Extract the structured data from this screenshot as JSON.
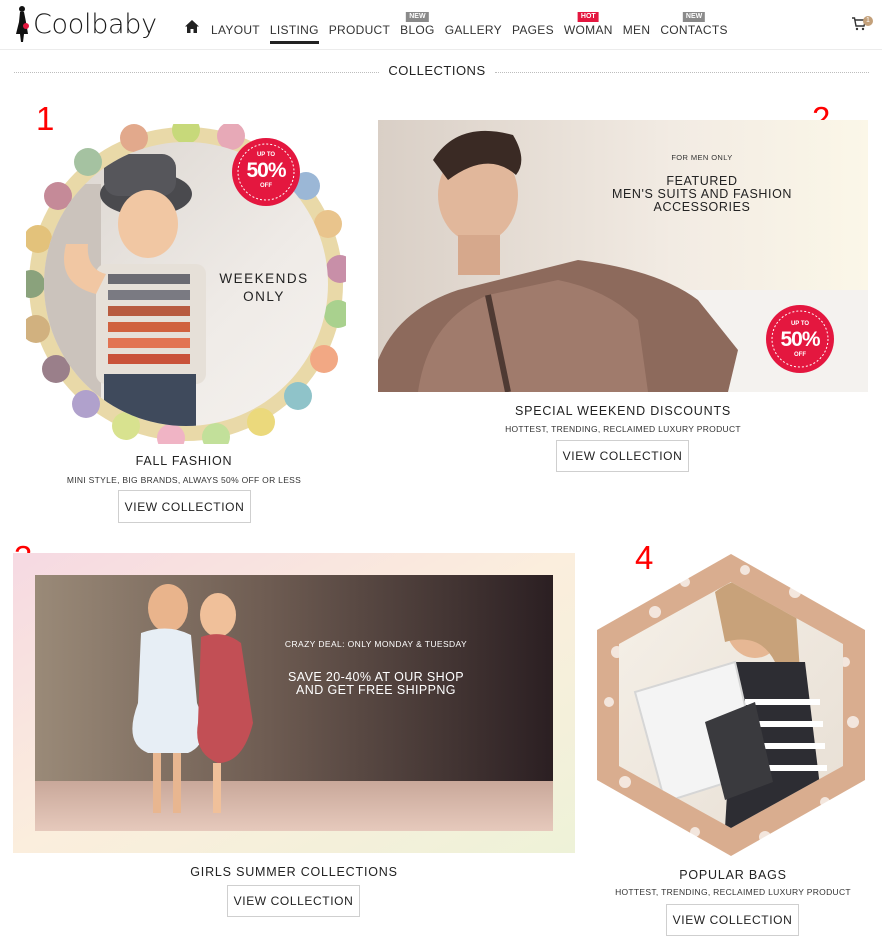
{
  "header": {
    "logo_text": "Coolbaby",
    "nav": [
      {
        "label": "LAYOUT",
        "badge": ""
      },
      {
        "label": "LISTING",
        "badge": ""
      },
      {
        "label": "PRODUCT",
        "badge": ""
      },
      {
        "label": "BLOG",
        "badge": "NEW"
      },
      {
        "label": "GALLERY",
        "badge": ""
      },
      {
        "label": "PAGES",
        "badge": ""
      },
      {
        "label": "WOMAN",
        "badge": "HOT"
      },
      {
        "label": "MEN",
        "badge": ""
      },
      {
        "label": "CONTACTS",
        "badge": "NEW"
      }
    ],
    "active_nav": "LISTING",
    "cart_count": "1"
  },
  "section": {
    "title": "COLLECTIONS"
  },
  "annotations": [
    "1",
    "2",
    "3",
    "4"
  ],
  "collections": [
    {
      "title": "FALL FASHION",
      "subtitle": "MINI STYLE, BIG BRANDS, ALWAYS 50% OFF OR LESS",
      "button": "VIEW COLLECTION",
      "overlay_lines": [
        "WEEKENDS",
        "ONLY"
      ],
      "badge": {
        "top": "UP TO",
        "big": "50%",
        "bottom": "OFF"
      }
    },
    {
      "title": "SPECIAL WEEKEND DISCOUNTS",
      "subtitle": "HOTTEST, TRENDING, RECLAIMED LUXURY PRODUCT",
      "button": "VIEW COLLECTION",
      "overlay_small": "FOR MEN ONLY",
      "overlay_lines": [
        "FEATURED",
        "MEN'S SUITS AND FASHION",
        "ACCESSORIES"
      ],
      "badge": {
        "top": "UP TO",
        "big": "50%",
        "bottom": "OFF"
      }
    },
    {
      "title": "GIRLS SUMMER COLLECTIONS",
      "button": "VIEW COLLECTION",
      "overlay_small": "CRAZY DEAL: ONLY MONDAY & TUESDAY",
      "overlay_lines": [
        "SAVE 20-40% AT OUR SHOP",
        "AND GET FREE SHIPPNG"
      ]
    },
    {
      "title": "POPULAR BAGS",
      "subtitle": "HOTTEST, TRENDING, RECLAIMED LUXURY PRODUCT",
      "button": "VIEW COLLECTION"
    }
  ],
  "colors": {
    "badge_red": "#e4173f",
    "annotation_red": "#ff0000",
    "cart_badge": "#c3a07a"
  }
}
